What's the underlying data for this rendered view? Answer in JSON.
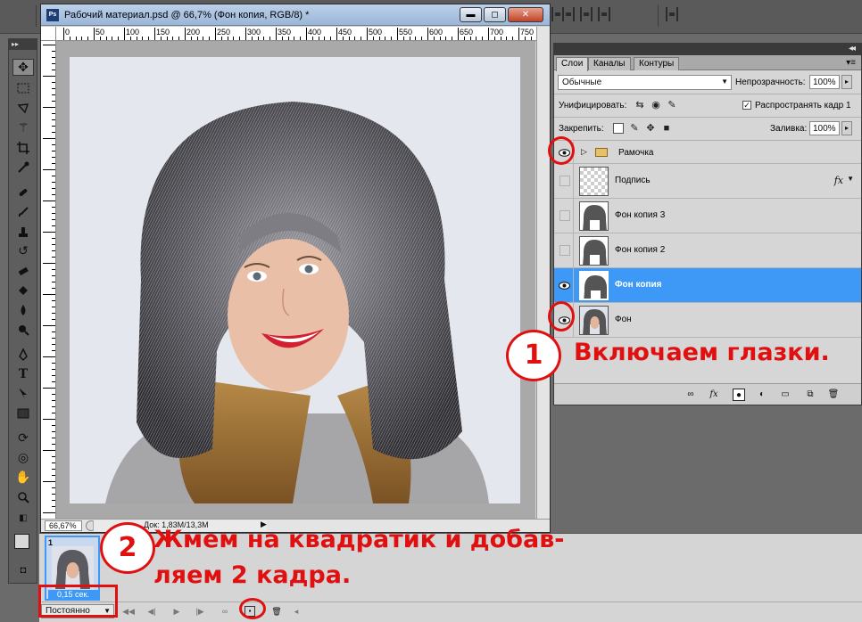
{
  "document": {
    "title": "Рабочий материал.psd @ 66,7% (Фон копия, RGB/8) *",
    "ruler_labels": [
      "0",
      "50",
      "100",
      "150",
      "200",
      "250",
      "300",
      "350",
      "400",
      "450",
      "500",
      "550",
      "600",
      "650",
      "700",
      "750"
    ],
    "zoom": "66,67%",
    "info": "Док: 1,83M/13,3M",
    "window_buttons": {
      "minimize": "▬",
      "restore": "◻",
      "close": "✕"
    }
  },
  "layers_panel": {
    "tabs": [
      {
        "label": "Слои",
        "active": true
      },
      {
        "label": "Каналы",
        "active": false
      },
      {
        "label": "Контуры",
        "active": false
      }
    ],
    "blend_mode": "Обычные",
    "opacity_label": "Непрозрачность:",
    "opacity_value": "100%",
    "unify_label": "Унифицировать:",
    "propagate_label": "Распространять кадр 1",
    "lock_label": "Закрепить:",
    "fill_label": "Заливка:",
    "fill_value": "100%",
    "layers": [
      {
        "name": "Рамочка",
        "type": "group",
        "visible": true
      },
      {
        "name": "Подпись",
        "type": "text",
        "visible": false,
        "fx": "fx"
      },
      {
        "name": "Фон копия 3",
        "type": "image",
        "visible": false
      },
      {
        "name": "Фон копия 2",
        "type": "image",
        "visible": false
      },
      {
        "name": "Фон копия",
        "type": "image",
        "visible": true,
        "selected": true
      },
      {
        "name": "Фон",
        "type": "image",
        "visible": true
      }
    ]
  },
  "animation": {
    "frame_number": "1",
    "frame_time": "0,15 сек.",
    "loop_mode": "Постоянно"
  },
  "annotations": {
    "step1_number": "1",
    "step1_text": "Включаем глазки.",
    "step2_number": "2",
    "step2_line1": "Жмем на квадратик и добав-",
    "step2_line2": "ляем 2 кадра."
  },
  "colors": {
    "selection_blue": "#3d99f5",
    "annotation_red": "#e01010",
    "panel_gray": "#d6d6d6"
  }
}
